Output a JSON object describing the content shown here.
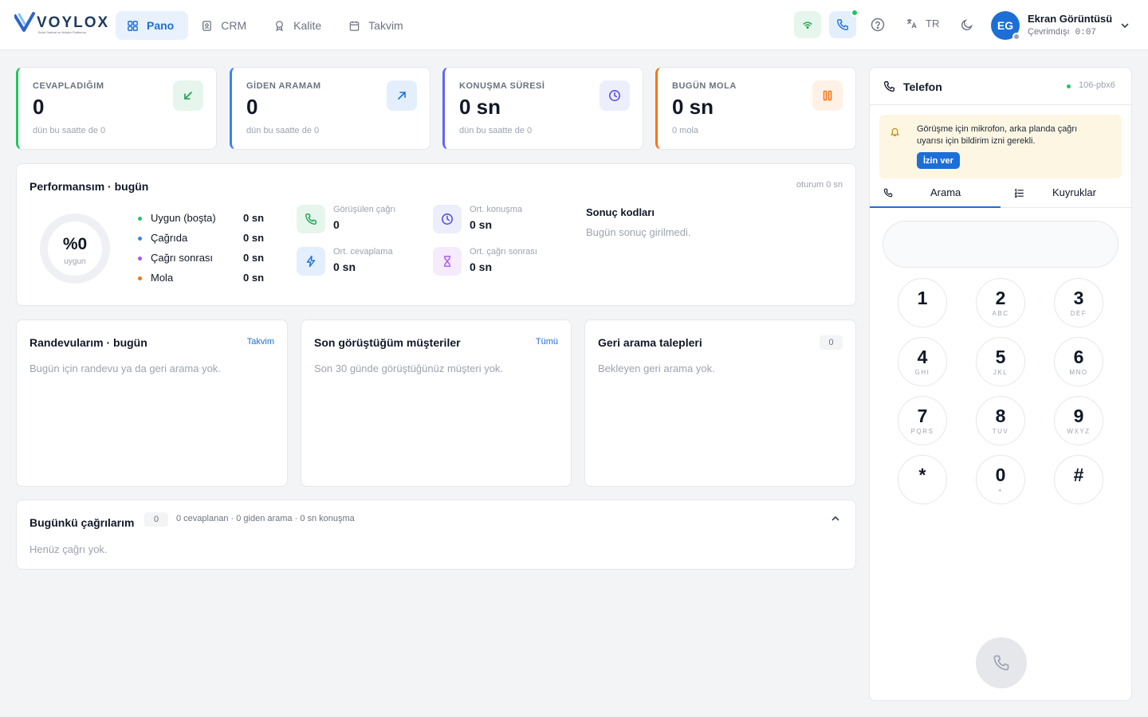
{
  "brand": {
    "name": "VOYLOX",
    "tagline": "Bulut Santral ve İletişim Platformu"
  },
  "nav": [
    {
      "label": "Pano",
      "icon": "dashboard-icon",
      "active": true
    },
    {
      "label": "CRM",
      "icon": "contacts-icon",
      "active": false
    },
    {
      "label": "Kalite",
      "icon": "award-icon",
      "active": false
    },
    {
      "label": "Takvim",
      "icon": "calendar-icon",
      "active": false
    }
  ],
  "topbar": {
    "lang": "TR"
  },
  "user": {
    "initials": "EG",
    "name": "Ekran Görüntüsü",
    "status": "Çevrimdışı",
    "timer": "0:07"
  },
  "stats": [
    {
      "label": "CEVAPLADIĞIM",
      "value": "0",
      "sub": "dün bu saatte de 0",
      "icon": "arrow-down-left-icon",
      "color": "#16a34a",
      "bg": "#e6f6ec"
    },
    {
      "label": "GİDEN ARAMAM",
      "value": "0",
      "sub": "dün bu saatte de 0",
      "icon": "arrow-up-right-icon",
      "color": "#1d6fd6",
      "bg": "#e3effc"
    },
    {
      "label": "KONUŞMA SÜRESİ",
      "value": "0 sn",
      "sub": "dün bu saatte de 0",
      "icon": "clock-icon",
      "color": "#4f46e5",
      "bg": "#eceefc"
    },
    {
      "label": "BUGÜN MOLA",
      "value": "0 sn",
      "sub": "0 mola",
      "icon": "pause-icon",
      "color": "#f97316",
      "bg": "#fff1e6"
    }
  ],
  "performance": {
    "title": "Performansım · bugün",
    "session": "oturum 0 sn",
    "donut_value": "%0",
    "donut_label": "uygun",
    "donut_percent": 0,
    "legend": [
      {
        "name": "Uygun (boşta)",
        "value": "0 sn",
        "color": "#22c55e"
      },
      {
        "name": "Çağrıda",
        "value": "0 sn",
        "color": "#3b82f6"
      },
      {
        "name": "Çağrı sonrası",
        "value": "0 sn",
        "color": "#a855f7"
      },
      {
        "name": "Mola",
        "value": "0 sn",
        "color": "#f97316"
      }
    ],
    "metrics": [
      {
        "label": "Görüşülen çağrı",
        "value": "0",
        "icon": "phone-icon",
        "color": "#16a34a",
        "bg": "#e6f6ec"
      },
      {
        "label": "Ort. konuşma",
        "value": "0 sn",
        "icon": "clock-icon",
        "color": "#4f46e5",
        "bg": "#eceefc"
      },
      {
        "label": "Ort. cevaplama",
        "value": "0 sn",
        "icon": "lightning-icon",
        "color": "#1d6fd6",
        "bg": "#e3effc"
      },
      {
        "label": "Ort. çağrı sonrası",
        "value": "0 sn",
        "icon": "hourglass-icon",
        "color": "#a855f7",
        "bg": "#f5ebfd"
      }
    ],
    "result_codes_title": "Sonuç kodları",
    "result_codes_empty": "Bugün sonuç girilmedi."
  },
  "appointments": {
    "title": "Randevularım · bugün",
    "link": "Takvim",
    "empty": "Bugün için randevu ya da geri arama yok."
  },
  "recent": {
    "title": "Son görüştüğüm müşteriler",
    "link": "Tümü",
    "empty": "Son 30 günde görüştüğünüz müşteri yok."
  },
  "callbacks": {
    "title": "Geri arama talepleri",
    "count": "0",
    "empty": "Bekleyen geri arama yok."
  },
  "calls": {
    "title": "Bugünkü çağrılarım",
    "count": "0",
    "summary": "0 cevaplanan · 0 giden arama · 0 sn konuşma",
    "empty": "Henüz çağrı yok."
  },
  "phone": {
    "title": "Telefon",
    "extension": "106-pbx6",
    "notice": "Görüşme için mikrofon, arka planda çağrı uyarısı için bildirim izni gerekli.",
    "allow_button": "İzin ver",
    "tabs": [
      {
        "label": "Arama",
        "active": true
      },
      {
        "label": "Kuyruklar",
        "active": false
      }
    ],
    "input_value": "",
    "keys": [
      {
        "d": "1",
        "l": ""
      },
      {
        "d": "2",
        "l": "ABC"
      },
      {
        "d": "3",
        "l": "DEF"
      },
      {
        "d": "4",
        "l": "GHI"
      },
      {
        "d": "5",
        "l": "JKL"
      },
      {
        "d": "6",
        "l": "MNO"
      },
      {
        "d": "7",
        "l": "PQRS"
      },
      {
        "d": "8",
        "l": "TUV"
      },
      {
        "d": "9",
        "l": "WXYZ"
      },
      {
        "d": "*",
        "l": ""
      },
      {
        "d": "0",
        "l": "+"
      },
      {
        "d": "#",
        "l": ""
      }
    ]
  }
}
